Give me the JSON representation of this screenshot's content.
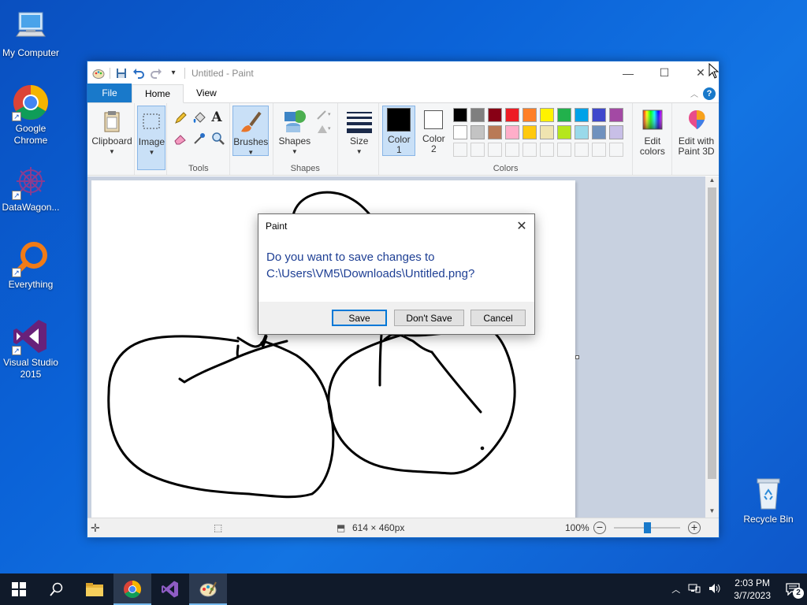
{
  "desktop": {
    "icons": [
      {
        "label": "My Computer",
        "icon": "computer-icon"
      },
      {
        "label": "Google Chrome",
        "icon": "chrome-icon"
      },
      {
        "label": "DataWagon...",
        "icon": "datawagon-icon"
      },
      {
        "label": "Everything",
        "icon": "everything-search-icon"
      },
      {
        "label": "Visual Studio 2015",
        "icon": "visual-studio-icon"
      },
      {
        "label": "Recycle Bin",
        "icon": "recycle-bin-icon"
      }
    ]
  },
  "window": {
    "title": "Untitled - Paint",
    "tabs": [
      "File",
      "Home",
      "View"
    ],
    "groups": {
      "clipboard": "Clipboard",
      "image": "Image",
      "tools": "Tools",
      "brushes": "Brushes",
      "shapes_btn": "Shapes",
      "shapes": "Shapes",
      "size": "Size",
      "color1_a": "Color",
      "color1_b": "1",
      "color2_a": "Color",
      "color2_b": "2",
      "colors": "Colors",
      "edit_colors_a": "Edit",
      "edit_colors_b": "colors",
      "paint3d_a": "Edit with",
      "paint3d_b": "Paint 3D"
    },
    "palette_row1": [
      "#000000",
      "#7f7f7f",
      "#880015",
      "#ed1c24",
      "#ff7f27",
      "#fff200",
      "#22b14c",
      "#00a2e8",
      "#3f48cc",
      "#a349a4"
    ],
    "palette_row2": [
      "#ffffff",
      "#c3c3c3",
      "#b97a57",
      "#ffaec9",
      "#ffc90e",
      "#efe4b0",
      "#b5e61d",
      "#99d9ea",
      "#7092be",
      "#c8bfe7"
    ],
    "color1": "#000000",
    "color2": "#ffffff",
    "status": {
      "image_size": "614 × 460px",
      "zoom": "100%",
      "zoom_level": 0.5
    }
  },
  "dialog": {
    "title": "Paint",
    "message_line1": "Do you want to save changes to",
    "message_line2": "C:\\Users\\VM5\\Downloads\\Untitled.png?",
    "save": "Save",
    "dont_save": "Don't Save",
    "cancel": "Cancel"
  },
  "taskbar": {
    "time": "2:03 PM",
    "date": "3/7/2023",
    "notifications": "2"
  }
}
